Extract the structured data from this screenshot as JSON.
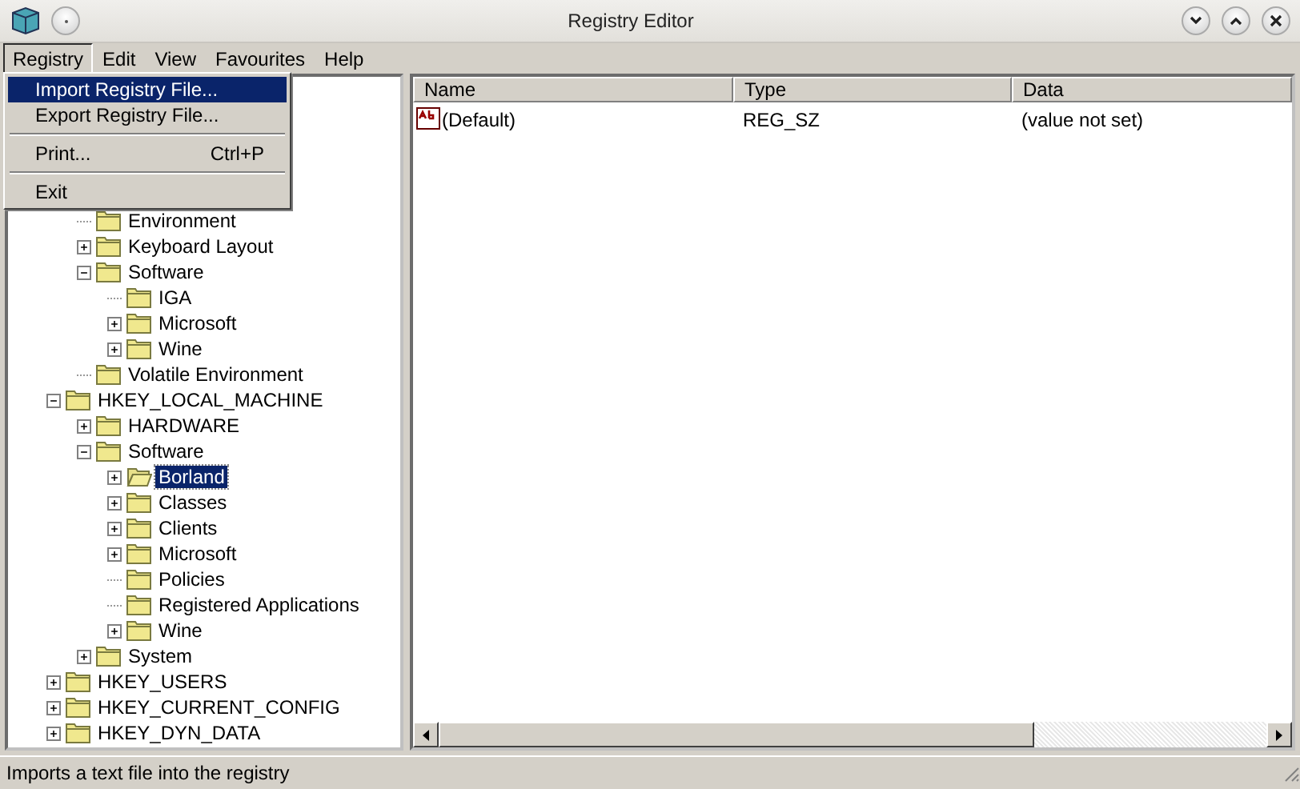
{
  "window": {
    "title": "Registry Editor"
  },
  "menubar": [
    {
      "label": "Registry",
      "selected": true
    },
    {
      "label": "Edit",
      "selected": false
    },
    {
      "label": "View",
      "selected": false
    },
    {
      "label": "Favourites",
      "selected": false
    },
    {
      "label": "Help",
      "selected": false
    }
  ],
  "menu": {
    "items": [
      {
        "kind": "item",
        "label": "Import Registry File...",
        "selected": true
      },
      {
        "kind": "item",
        "label": "Export Registry File...",
        "selected": false
      },
      {
        "kind": "separator"
      },
      {
        "kind": "item",
        "label": "Print...",
        "shortcut": "Ctrl+P",
        "selected": false
      },
      {
        "kind": "separator"
      },
      {
        "kind": "item",
        "label": "Exit",
        "selected": false
      }
    ]
  },
  "tree": {
    "partial_children": [
      {
        "label": "Environment",
        "selected": false
      },
      {
        "label": "Keyboard Layout",
        "expanded": false,
        "selected": false
      },
      {
        "label": "Software",
        "expanded": true,
        "selected": false,
        "children": [
          {
            "label": "IGA",
            "selected": false
          },
          {
            "label": "Microsoft",
            "expanded": false,
            "selected": false
          },
          {
            "label": "Wine",
            "expanded": false,
            "selected": false
          }
        ]
      },
      {
        "label": "Volatile Environment",
        "selected": false
      }
    ],
    "roots": [
      {
        "label": "HKEY_LOCAL_MACHINE",
        "expanded": true,
        "selected": false,
        "children": [
          {
            "label": "HARDWARE",
            "expanded": false,
            "selected": false
          },
          {
            "label": "Software",
            "expanded": true,
            "selected": false,
            "children": [
              {
                "label": "Borland",
                "expanded": false,
                "selected": true
              },
              {
                "label": "Classes",
                "expanded": false,
                "selected": false
              },
              {
                "label": "Clients",
                "expanded": false,
                "selected": false
              },
              {
                "label": "Microsoft",
                "expanded": false,
                "selected": false
              },
              {
                "label": "Policies",
                "selected": false
              },
              {
                "label": "Registered Applications",
                "selected": false
              },
              {
                "label": "Wine",
                "expanded": false,
                "selected": false
              }
            ]
          },
          {
            "label": "System",
            "expanded": false,
            "selected": false
          }
        ]
      },
      {
        "label": "HKEY_USERS",
        "expanded": false,
        "selected": false
      },
      {
        "label": "HKEY_CURRENT_CONFIG",
        "expanded": false,
        "selected": false
      },
      {
        "label": "HKEY_DYN_DATA",
        "expanded": false,
        "selected": false
      }
    ]
  },
  "table": {
    "columns": [
      "Name",
      "Type",
      "Data"
    ],
    "rows": [
      {
        "name": "(Default)",
        "type": "REG_SZ",
        "data": "(value not set)"
      }
    ]
  },
  "status_bar": "Imports a text file into the registry"
}
